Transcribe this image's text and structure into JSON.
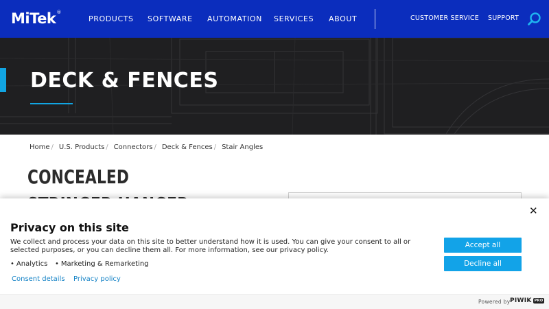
{
  "header": {
    "logo_text": "MiTek",
    "logo_mark": "®",
    "nav_items": [
      "PRODUCTS",
      "SOFTWARE",
      "AUTOMATION",
      "SERVICES",
      "ABOUT"
    ],
    "secondary_items": [
      "CUSTOMER SERVICE",
      "SUPPORT"
    ],
    "search_icon": "search-icon",
    "background_color": "#0b2dbd"
  },
  "hero": {
    "title": "DECK & FENCES",
    "accent_color": "#11a5e3"
  },
  "breadcrumb": [
    "Home",
    "U.S. Products",
    "Connectors",
    "Deck & Fences",
    "Stair Angles"
  ],
  "product": {
    "title": "CONCEALED STRINGER HANGER"
  },
  "privacy_banner": {
    "title": "Privacy on this site",
    "description": "We collect and process your data on this site to better understand how it is used. You can give your consent to all or selected purposes, or you can decline them all. For more information, see our privacy policy.",
    "purposes": [
      "Analytics",
      "Marketing & Remarketing"
    ],
    "links": [
      "Consent details",
      "Privacy policy"
    ],
    "accept_label": "Accept all",
    "decline_label": "Decline all",
    "close_icon": "close-icon",
    "powered_by": "Powered by",
    "powered_brand": "PIWIK",
    "powered_badge": "PRO",
    "button_color": "#12a3e8"
  }
}
